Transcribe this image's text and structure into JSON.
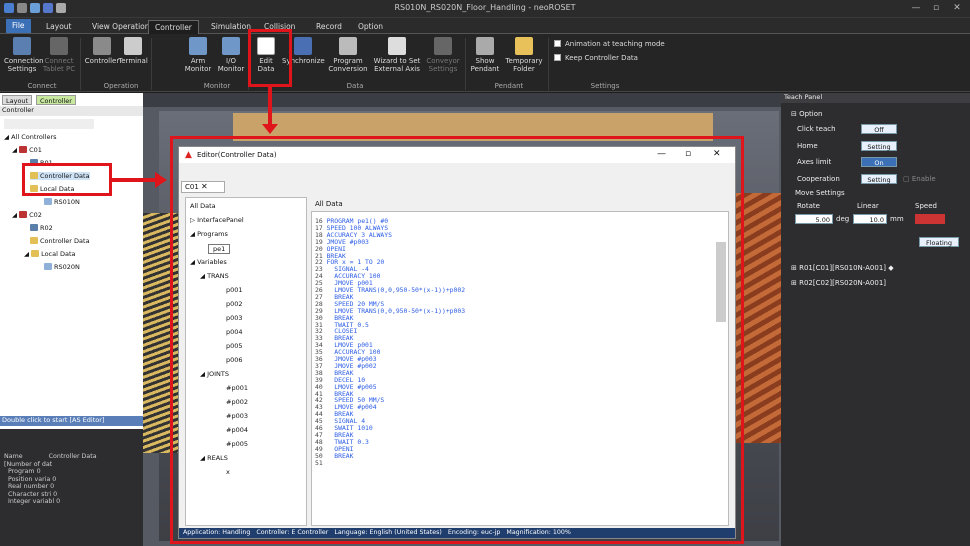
{
  "window": {
    "title": "RS010N_RS020N_Floor_Handling - neoROSET",
    "controls": [
      "—",
      "▫",
      "✕"
    ]
  },
  "menu_tabs": [
    {
      "label": "File"
    },
    {
      "label": "Layout"
    },
    {
      "label": "View Operation"
    },
    {
      "label": "Controller"
    },
    {
      "label": "Simulation"
    },
    {
      "label": "Collision"
    },
    {
      "label": "Record"
    },
    {
      "label": "Option"
    }
  ],
  "ribbon": {
    "buttons": [
      {
        "label": "Connection\nSettings"
      },
      {
        "label": "Connect\nTablet PC"
      },
      {
        "label": "Controller"
      },
      {
        "label": "Terminal"
      },
      {
        "label": "Arm\nMonitor"
      },
      {
        "label": "I/O\nMonitor"
      },
      {
        "label": "Edit\nData"
      },
      {
        "label": "Synchronize"
      },
      {
        "label": "Program\nConversion"
      },
      {
        "label": "Wizard to Set\nExternal Axis"
      },
      {
        "label": "Conveyor\nSettings"
      },
      {
        "label": "Show\nPendant"
      },
      {
        "label": "Temporary\nFolder"
      }
    ],
    "groups": [
      "Connect",
      "Operation",
      "Monitor",
      "Data",
      "Pendant",
      "Settings"
    ],
    "checks": [
      "Animation at teaching mode",
      "Keep Controller Data"
    ]
  },
  "left_panel": {
    "tabs": [
      "Layout",
      "Controller"
    ],
    "header": "Controller",
    "tree": [
      "All Controllers",
      "C01",
      "R01",
      "Controller Data",
      "Local Data",
      "RS010N",
      "C02",
      "R02",
      "Controller Data",
      "Local Data",
      "RS020N"
    ],
    "hint": "Double click to start [AS Editor]",
    "props": {
      "name_label": "Name",
      "name_value": "Controller Data",
      "rows": [
        "[Number of dat",
        "Program      0",
        "Position varia 0",
        "Real number  0",
        "Character stri 0",
        "Integer variabl 0"
      ]
    }
  },
  "teach_panel": {
    "title": "Teach Panel",
    "option_label": "Option",
    "rows": [
      {
        "label": "Click teach",
        "btn": "Off"
      },
      {
        "label": "Home",
        "btn": "Setting"
      },
      {
        "label": "Axes limit",
        "btn": "On"
      },
      {
        "label": "Cooperation",
        "btn": "Setting"
      }
    ],
    "enable": "Enable",
    "move_settings": "Move Settings",
    "rotate_label": "Rotate",
    "linear_label": "Linear",
    "speed_label": "Speed",
    "rotate_value": "5.00",
    "rotate_unit": "deg",
    "linear_value": "10.0",
    "linear_unit": "mm",
    "floating": "Floating",
    "robots": [
      "R01[C01][RS010N-A001] ◆",
      "R02[C02][RS020N-A001]"
    ]
  },
  "editor": {
    "title": "Editor(Controller Data)",
    "tab": "C01",
    "tree_root": "All Data",
    "tree": [
      "InterfacePanel",
      "Programs",
      "pe1",
      "Variables",
      "TRANS",
      "p001",
      "p002",
      "p003",
      "p004",
      "p005",
      "p006",
      "JOINTS",
      "#p001",
      "#p002",
      "#p003",
      "#p004",
      "#p005",
      "REALS",
      "x"
    ],
    "code_tab": "All Data",
    "status": [
      "Application: Handling",
      "Controller: E Controller",
      "Language: English (United States)",
      "Encoding: euc-jp",
      "Magnification: 100%"
    ]
  },
  "code_lines": [
    [
      "16",
      "PROGRAM pe1() #0"
    ],
    [
      "17",
      "SPEED 100 ALWAYS"
    ],
    [
      "18",
      "ACCURACY 3 ALWAYS"
    ],
    [
      "19",
      "JMOVE #p003"
    ],
    [
      "20",
      "OPENI"
    ],
    [
      "21",
      "BREAK"
    ],
    [
      "22",
      "FOR x = 1 TO 20"
    ],
    [
      "23",
      "  SIGNAL -4"
    ],
    [
      "24",
      "  ACCURACY 100"
    ],
    [
      "25",
      "  JMOVE p001"
    ],
    [
      "26",
      "  LMOVE TRANS(0,0,950-50*(x-1))+p002"
    ],
    [
      "27",
      "  BREAK"
    ],
    [
      "28",
      "  SPEED 20 MM/S"
    ],
    [
      "29",
      "  LMOVE TRANS(0,0,950-50*(x-1))+p003"
    ],
    [
      "30",
      "  BREAK"
    ],
    [
      "31",
      "  TWAIT 0.5"
    ],
    [
      "32",
      "  CLOSEI"
    ],
    [
      "33",
      "  BREAK"
    ],
    [
      "34",
      "  LMOVE p001"
    ],
    [
      "35",
      "  ACCURACY 100"
    ],
    [
      "36",
      "  JMOVE #p003"
    ],
    [
      "37",
      "  JMOVE #p002"
    ],
    [
      "38",
      "  BREAK"
    ],
    [
      "39",
      "  DECEL 10"
    ],
    [
      "40",
      "  LMOVE #p005"
    ],
    [
      "41",
      "  BREAK"
    ],
    [
      "42",
      "  SPEED 50 MM/S"
    ],
    [
      "43",
      "  LMOVE #p004"
    ],
    [
      "44",
      "  BREAK"
    ],
    [
      "45",
      "  SIGNAL 4"
    ],
    [
      "46",
      "  SWAIT 1010"
    ],
    [
      "47",
      "  BREAK"
    ],
    [
      "48",
      "  TWAIT 0.3"
    ],
    [
      "49",
      "  OPENI"
    ],
    [
      "50",
      "  BREAK"
    ],
    [
      "51",
      ""
    ]
  ]
}
